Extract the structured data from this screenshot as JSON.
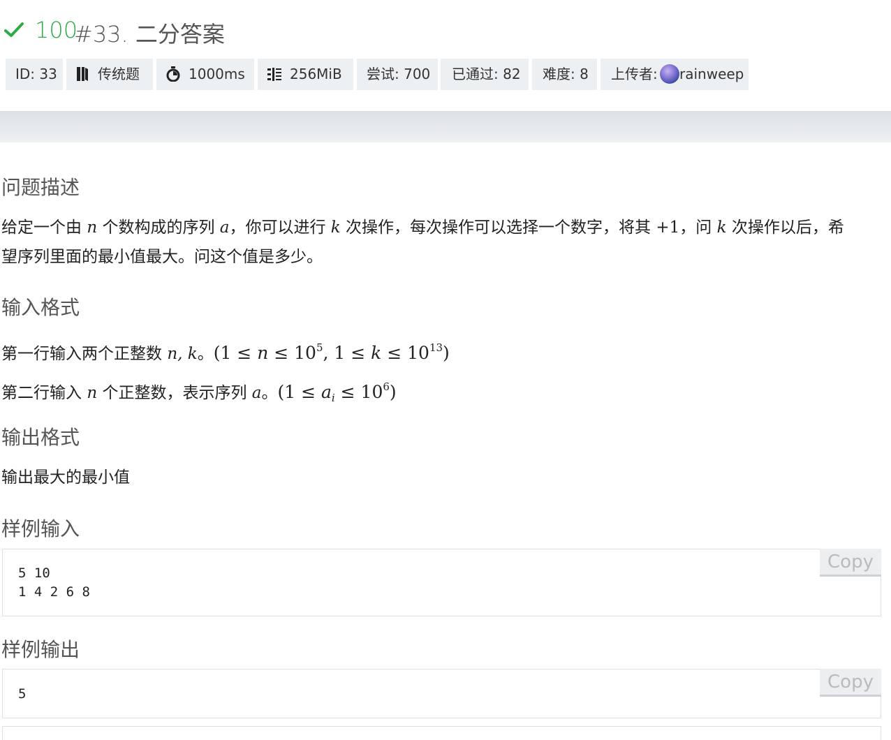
{
  "header": {
    "score": "100",
    "title": "#33. 二分答案"
  },
  "badges": {
    "id": "ID: 33",
    "type": "传统题",
    "time": "1000ms",
    "memory": "256MiB",
    "tries": "尝试: 700",
    "passed": "已通过: 82",
    "difficulty": "难度: 8",
    "uploader_label": "上传者:",
    "uploader_name": "rainweep"
  },
  "sections": {
    "description_title": "问题描述",
    "description": {
      "t1": "给定一个由 ",
      "n": "n",
      "t2": " 个数构成的序列 ",
      "a": "a",
      "t3": "，你可以进行 ",
      "k": "k",
      "t4": " 次操作，每次操作可以选择一个数字，将其 ",
      "plus1": "+1",
      "t5": "，问 ",
      "k2": "k",
      "t6": " 次操作以后，希",
      "line2": "望序列里面的最小值最大。问这个值是多少。"
    },
    "input_title": "输入格式",
    "input_line1_text": "第一行输入两个正整数 ",
    "input_line1_vars": "n, k",
    "input_line1_sep": "。",
    "input_line1_c1": "(1 ≤ ",
    "input_line1_n": "n",
    "input_line1_c2": " ≤ 10",
    "input_line1_exp1": "5",
    "input_line1_c3": ", 1 ≤ ",
    "input_line1_k": "k",
    "input_line1_c4": " ≤ 10",
    "input_line1_exp2": "13",
    "input_line1_c5": ")",
    "input_line2_text": "第二行输入 ",
    "input_line2_n": "n",
    "input_line2_text2": " 个正整数，表示序列 ",
    "input_line2_a": "a",
    "input_line2_sep": "。",
    "input_line2_c1": "(1 ≤ ",
    "input_line2_ai": "a",
    "input_line2_sub": "i",
    "input_line2_c2": " ≤ 10",
    "input_line2_exp": "6",
    "input_line2_c3": ")",
    "output_title": "输出格式",
    "output_text": "输出最大的最小值",
    "sample_in_title": "样例输入",
    "sample_in": "5 10\n1 4 2 6 8",
    "sample_out_title": "样例输出",
    "sample_out": "5",
    "copy_label": "Copy"
  },
  "colors": {
    "accent_green": "#2eab48",
    "badge_bg": "#edf0f3"
  }
}
